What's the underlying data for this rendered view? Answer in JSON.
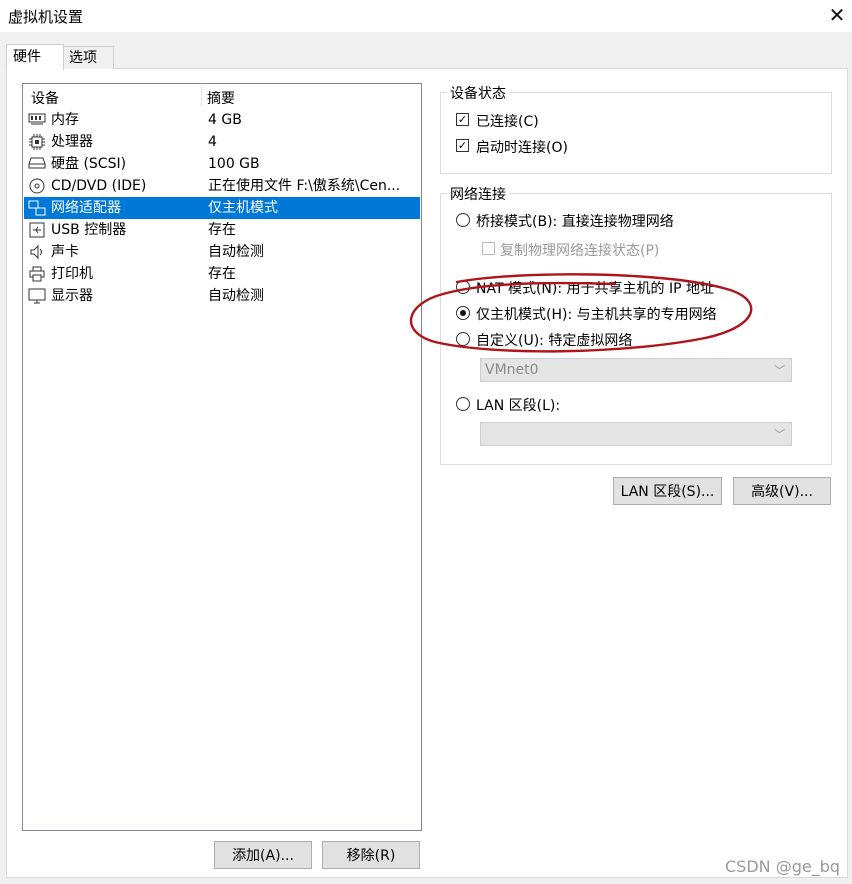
{
  "window": {
    "title": "虚拟机设置"
  },
  "tabs": [
    {
      "label": "硬件"
    },
    {
      "label": "选项"
    }
  ],
  "device_list": {
    "columns": [
      "设备",
      "摘要"
    ],
    "rows": [
      {
        "icon": "memory-icon",
        "name": "内存",
        "summary": "4 GB",
        "selected": false
      },
      {
        "icon": "cpu-icon",
        "name": "处理器",
        "summary": "4",
        "selected": false
      },
      {
        "icon": "hard-disk-icon",
        "name": "硬盘 (SCSI)",
        "summary": "100 GB",
        "selected": false
      },
      {
        "icon": "cd-dvd-icon",
        "name": "CD/DVD (IDE)",
        "summary": "正在使用文件 F:\\傲系统\\Cen...",
        "selected": false
      },
      {
        "icon": "network-adapter-icon",
        "name": "网络适配器",
        "summary": "仅主机模式",
        "selected": true
      },
      {
        "icon": "usb-icon",
        "name": "USB 控制器",
        "summary": "存在",
        "selected": false
      },
      {
        "icon": "sound-card-icon",
        "name": "声卡",
        "summary": "自动检测",
        "selected": false
      },
      {
        "icon": "printer-icon",
        "name": "打印机",
        "summary": "存在",
        "selected": false
      },
      {
        "icon": "display-icon",
        "name": "显示器",
        "summary": "自动检测",
        "selected": false
      }
    ],
    "add_button": "添加(A)...",
    "remove_button": "移除(R)"
  },
  "device_status": {
    "legend": "设备状态",
    "connected": {
      "label": "已连接(C)",
      "checked": true
    },
    "connect_at_power_on": {
      "label": "启动时连接(O)",
      "checked": true
    }
  },
  "network_connection": {
    "legend": "网络连接",
    "bridged": {
      "label": "桥接模式(B): 直接连接物理网络",
      "selected": false
    },
    "replicate_state": {
      "label": "复制物理网络连接状态(P)",
      "checked": false,
      "disabled": true
    },
    "nat": {
      "label": "NAT 模式(N): 用于共享主机的 IP 地址",
      "selected": false
    },
    "host_only": {
      "label": "仅主机模式(H): 与主机共享的专用网络",
      "selected": true
    },
    "custom": {
      "label": "自定义(U): 特定虚拟网络",
      "selected": false
    },
    "custom_select": {
      "value": "VMnet0"
    },
    "lan_segment": {
      "label": "LAN 区段(L):",
      "selected": false
    },
    "lan_select": {
      "value": ""
    }
  },
  "buttons": {
    "lan_segments": "LAN 区段(S)...",
    "advanced": "高级(V)..."
  },
  "annotation": {
    "color": "#b0141b"
  },
  "watermark": "CSDN @ge_bq"
}
